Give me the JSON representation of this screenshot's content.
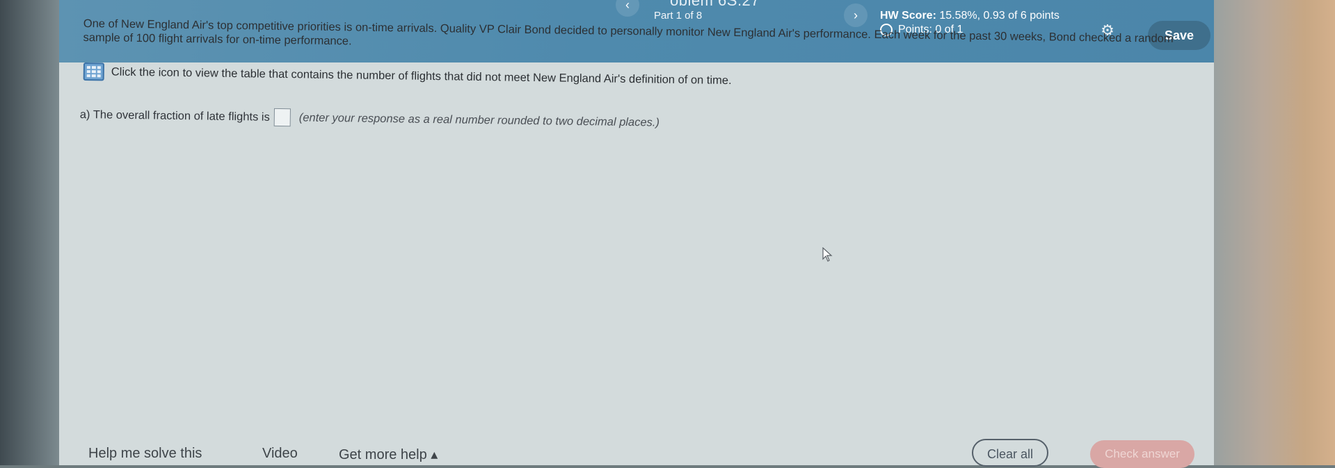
{
  "header": {
    "problem_title": "oblem 6S.27",
    "prev_arrow": "‹",
    "next_arrow": "›",
    "part_label": "Part 1 of 8",
    "hw_score_label": "HW Score:",
    "hw_score_value": "15.58%, 0.93 of 6 points",
    "points_text": "Points: 0 of 1",
    "save_label": "Save"
  },
  "question": {
    "text": "One of New England Air's top competitive priorities is on-time arrivals. Quality VP Clair Bond decided to personally monitor New England Air's performance. Each week for the past 30 weeks, Bond checked a random sample of 100 flight arrivals for on-time performance.",
    "table_link_text": "Click the icon to view the table that contains the number of flights that did not meet New England Air's definition of on time."
  },
  "part_a": {
    "prefix": "a) The overall fraction of late flights is",
    "hint": "(enter your response as a real number rounded to two decimal places.)",
    "answer_value": ""
  },
  "footer": {
    "help_me_solve": "Help me solve this",
    "video": "Video",
    "get_more_help": "Get more help ▴",
    "clear_all": "Clear all",
    "check_answer": "Check answer"
  },
  "icons": [
    "gear-icon",
    "table-icon",
    "radio-circle-icon",
    "cursor-icon",
    "chevron-left-icon",
    "chevron-right-icon"
  ],
  "colors": {
    "header_bg": "#4f8aad",
    "save_button": "#3f6f8c",
    "check_answer_button": "#d9a7a5",
    "content_bg": "#d3dbdc"
  }
}
